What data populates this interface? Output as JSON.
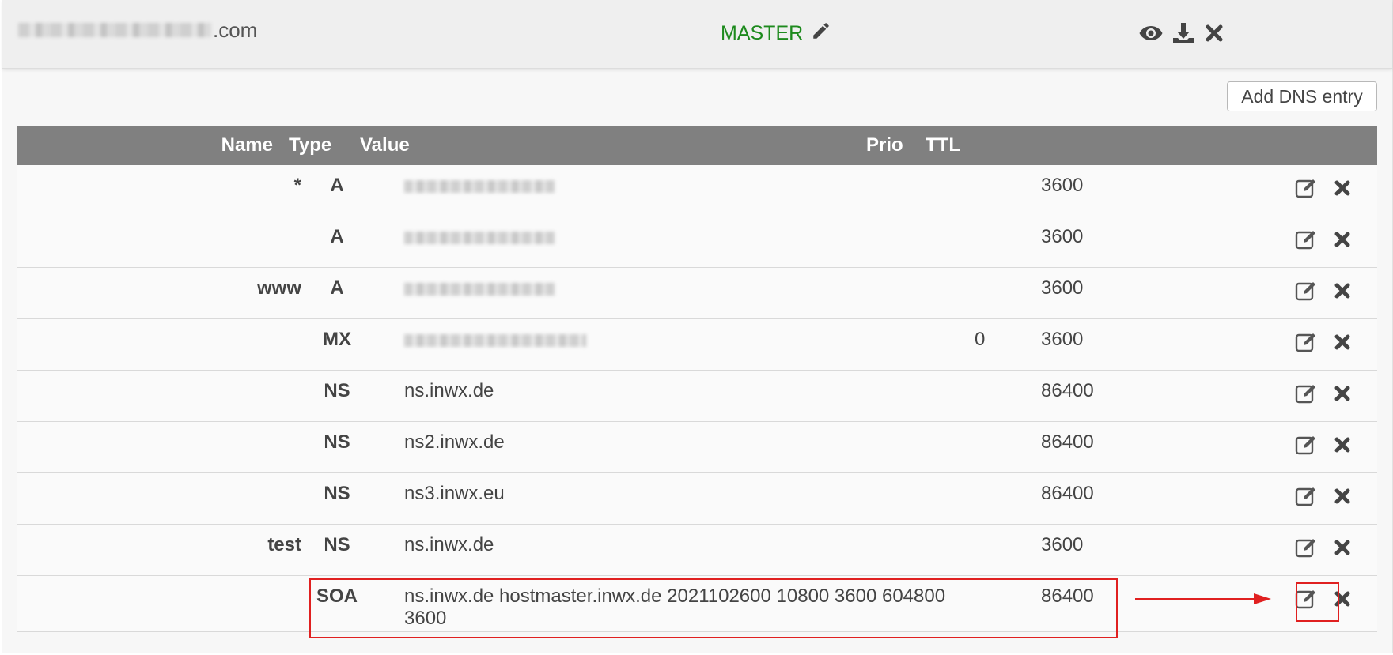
{
  "header": {
    "domain_suffix": ".com",
    "status_label": "MASTER",
    "status_color": "#1d8a1d",
    "icons": [
      "edit-pencil-icon",
      "eye-icon",
      "download-icon",
      "close-icon"
    ]
  },
  "toolbar": {
    "add_label": "Add DNS entry"
  },
  "table": {
    "columns": {
      "name": "Name",
      "type": "Type",
      "value": "Value",
      "prio": "Prio",
      "ttl": "TTL"
    },
    "rows": [
      {
        "name": "*",
        "type": "A",
        "value": "",
        "prio": "",
        "ttl": "3600"
      },
      {
        "name": "",
        "type": "A",
        "value": "",
        "prio": "",
        "ttl": "3600"
      },
      {
        "name": "www",
        "type": "A",
        "value": "",
        "prio": "",
        "ttl": "3600"
      },
      {
        "name": "",
        "type": "MX",
        "value": "",
        "prio": "0",
        "ttl": "3600"
      },
      {
        "name": "",
        "type": "NS",
        "value": "ns.inwx.de",
        "prio": "",
        "ttl": "86400"
      },
      {
        "name": "",
        "type": "NS",
        "value": "ns2.inwx.de",
        "prio": "",
        "ttl": "86400"
      },
      {
        "name": "",
        "type": "NS",
        "value": "ns3.inwx.eu",
        "prio": "",
        "ttl": "86400"
      },
      {
        "name": "test",
        "type": "NS",
        "value": "ns.inwx.de",
        "prio": "",
        "ttl": "3600"
      },
      {
        "name": "",
        "type": "SOA",
        "value": "ns.inwx.de hostmaster.inwx.de 2021102600 10800 3600 604800 3600",
        "prio": "",
        "ttl": "86400"
      }
    ],
    "row_icons": [
      "edit-icon",
      "delete-icon"
    ]
  },
  "annotation": {
    "color": "#e02020"
  }
}
